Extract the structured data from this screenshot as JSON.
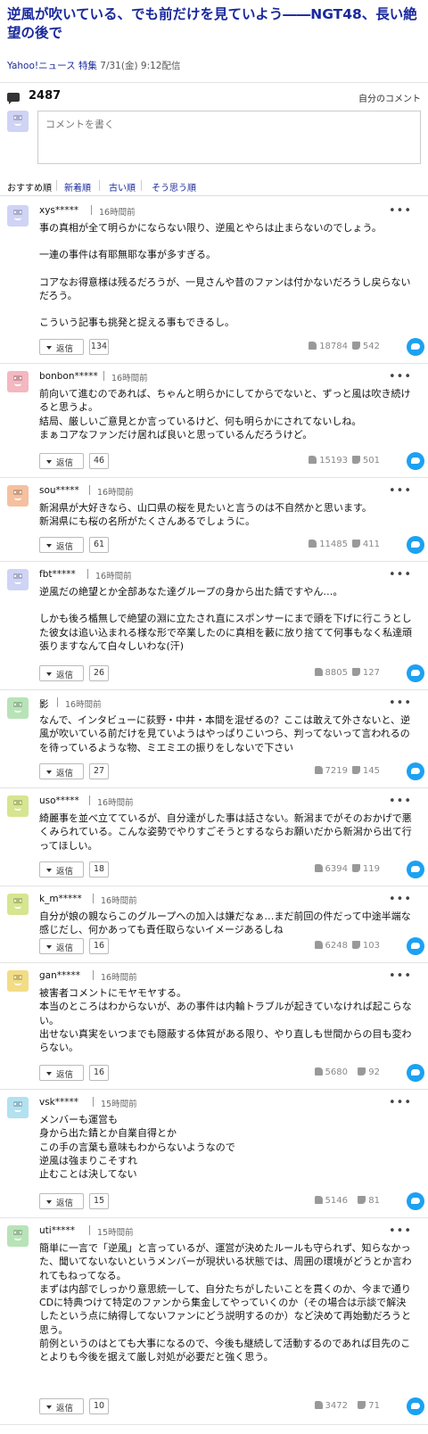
{
  "article": {
    "title": "逆風が吹いている、でも前だけを見ていよう――NGT48、長い絶望の後で",
    "source": "Yahoo!ニュース",
    "category": "特集",
    "date": "7/31(金) 9:12配信"
  },
  "comments_header": {
    "count": "2487",
    "my_comments_label": "自分のコメント",
    "input_placeholder": "コメントを書く"
  },
  "sort_options": [
    "おすすめ順",
    "新着順",
    "古い順",
    "そう思う順"
  ],
  "reply_label": "返信",
  "comments": [
    {
      "user": "xys*****",
      "time": "16時間前",
      "avatar_color": "#cfd3f5",
      "lines": [
        "事の真相が全て明らかにならない限り、逆風とやらは止まらないのでしょう。",
        "",
        "一連の事件は有耶無耶な事が多すぎる。",
        "",
        "コアなお得意様は残るだろうが、一見さんや昔のファンは付かないだろうし戻らないだろう。",
        "",
        "こういう記事も挑発と捉える事もできるし。"
      ],
      "replies": "134",
      "good": "18784",
      "bad": "542"
    },
    {
      "user": "bonbon*****",
      "time": "16時間前",
      "avatar_color": "#f3b8c0",
      "lines": [
        "前向いて進むのであれば、ちゃんと明らかにしてからでないと、ずっと風は吹き続けると思うよ。",
        "結局、厳しいご意見とか言っているけど、何も明らかにされてないしね。",
        "まぁコアなファンだけ居れば良いと思っているんだろうけど。"
      ],
      "replies": "46",
      "good": "15193",
      "bad": "501"
    },
    {
      "user": "sou*****",
      "time": "16時間前",
      "avatar_color": "#f5c09f",
      "lines": [
        "新潟県が大好きなら、山口県の桜を見たいと言うのは不自然かと思います。",
        "新潟県にも桜の名所がたくさんあるでしょうに。"
      ],
      "replies": "61",
      "good": "11485",
      "bad": "411"
    },
    {
      "user": "fbt*****",
      "time": "16時間前",
      "avatar_color": "#cfd3f5",
      "lines": [
        "逆風だの絶望とか全部あなた達グループの身から出た錆ですやん…。",
        "",
        "しかも後ろ楯無しで絶望の淵に立たされ直にスポンサーにまで頭を下げに行こうとした彼女は追い込まれる様な形で卒業したのに真相を藪に放り捨てて何事もなく私達頑張りますなんて白々しいわな(汗)"
      ],
      "replies": "26",
      "good": "8805",
      "bad": "127"
    },
    {
      "user": "影",
      "time": "16時間前",
      "avatar_color": "#b8e3b8",
      "lines": [
        "なんで、インタビューに荻野・中井・本間を混ぜるの？ここは敢えて外さないと、逆風が吹いている前だけを見ていようはやっぱりこいつら、判ってないって言われるのを待っているような物、ミエミエの振りをしないで下さい"
      ],
      "replies": "27",
      "good": "7219",
      "bad": "145"
    },
    {
      "user": "uso*****",
      "time": "16時間前",
      "avatar_color": "#d6e58f",
      "lines": [
        "綺麗事を並べ立てているが、自分達がした事は話さない。新潟までがそのおかげで悪くみられている。こんな姿勢でやりすごそうとするならお願いだから新潟から出て行ってほしい。"
      ],
      "replies": "18",
      "good": "6394",
      "bad": "119"
    },
    {
      "user": "k_m*****",
      "time": "16時間前",
      "avatar_color": "#d6e58f",
      "lines": [
        "自分が娘の親ならこのグループへの加入は嫌だなぁ…まだ前回の件だって中途半端な感じだし、何かあっても責任取らないイメージあるしね"
      ],
      "replies": "16",
      "good": "6248",
      "bad": "103"
    },
    {
      "user": "gan*****",
      "time": "16時間前",
      "avatar_color": "#f2dc86",
      "lines": [
        "被害者コメントにモヤモヤする。",
        "本当のところはわからないが、あの事件は内輪トラブルが起きていなければ起こらない。",
        "出せない真実をいつまでも隠蔽する体質がある限り、やり直しも世間からの目も変わらない。"
      ],
      "replies": "16",
      "good": "5680",
      "bad": "92"
    },
    {
      "user": "vsk*****",
      "time": "15時間前",
      "avatar_color": "#b2e1f0",
      "lines": [
        "メンバーも運営も",
        "身から出た錆とか自業自得とか",
        "この手の言葉も意味もわからないようなので",
        "逆風は強まりこそすれ",
        "止むことは決してない"
      ],
      "replies": "15",
      "good": "5146",
      "bad": "81"
    },
    {
      "user": "uti*****",
      "time": "15時間前",
      "avatar_color": "#b8e3b8",
      "lines": [
        "簡単に一言で「逆風」と言っているが、運営が決めたルールも守られず、知らなかった、聞いてないないというメンバーが現状いる状態では、周囲の環境がどうとか言われてもねってなる。",
        "まずは内部でしっかり意思統一して、自分たちがしたいことを貫くのか、今まで通りCDに特典つけて特定のファンから集金してやっていくのか（その場合は示談で解決したという点に納得してないファンにどう説明するのか）など決めて再始動だろうと思う。",
        "前例というのはとても大事になるので、今後も継続して活動するのであれば目先のことよりも今後を据えて厳し対処が必要だと強く思う。"
      ],
      "replies": "10",
      "good": "3472",
      "bad": "71"
    }
  ]
}
